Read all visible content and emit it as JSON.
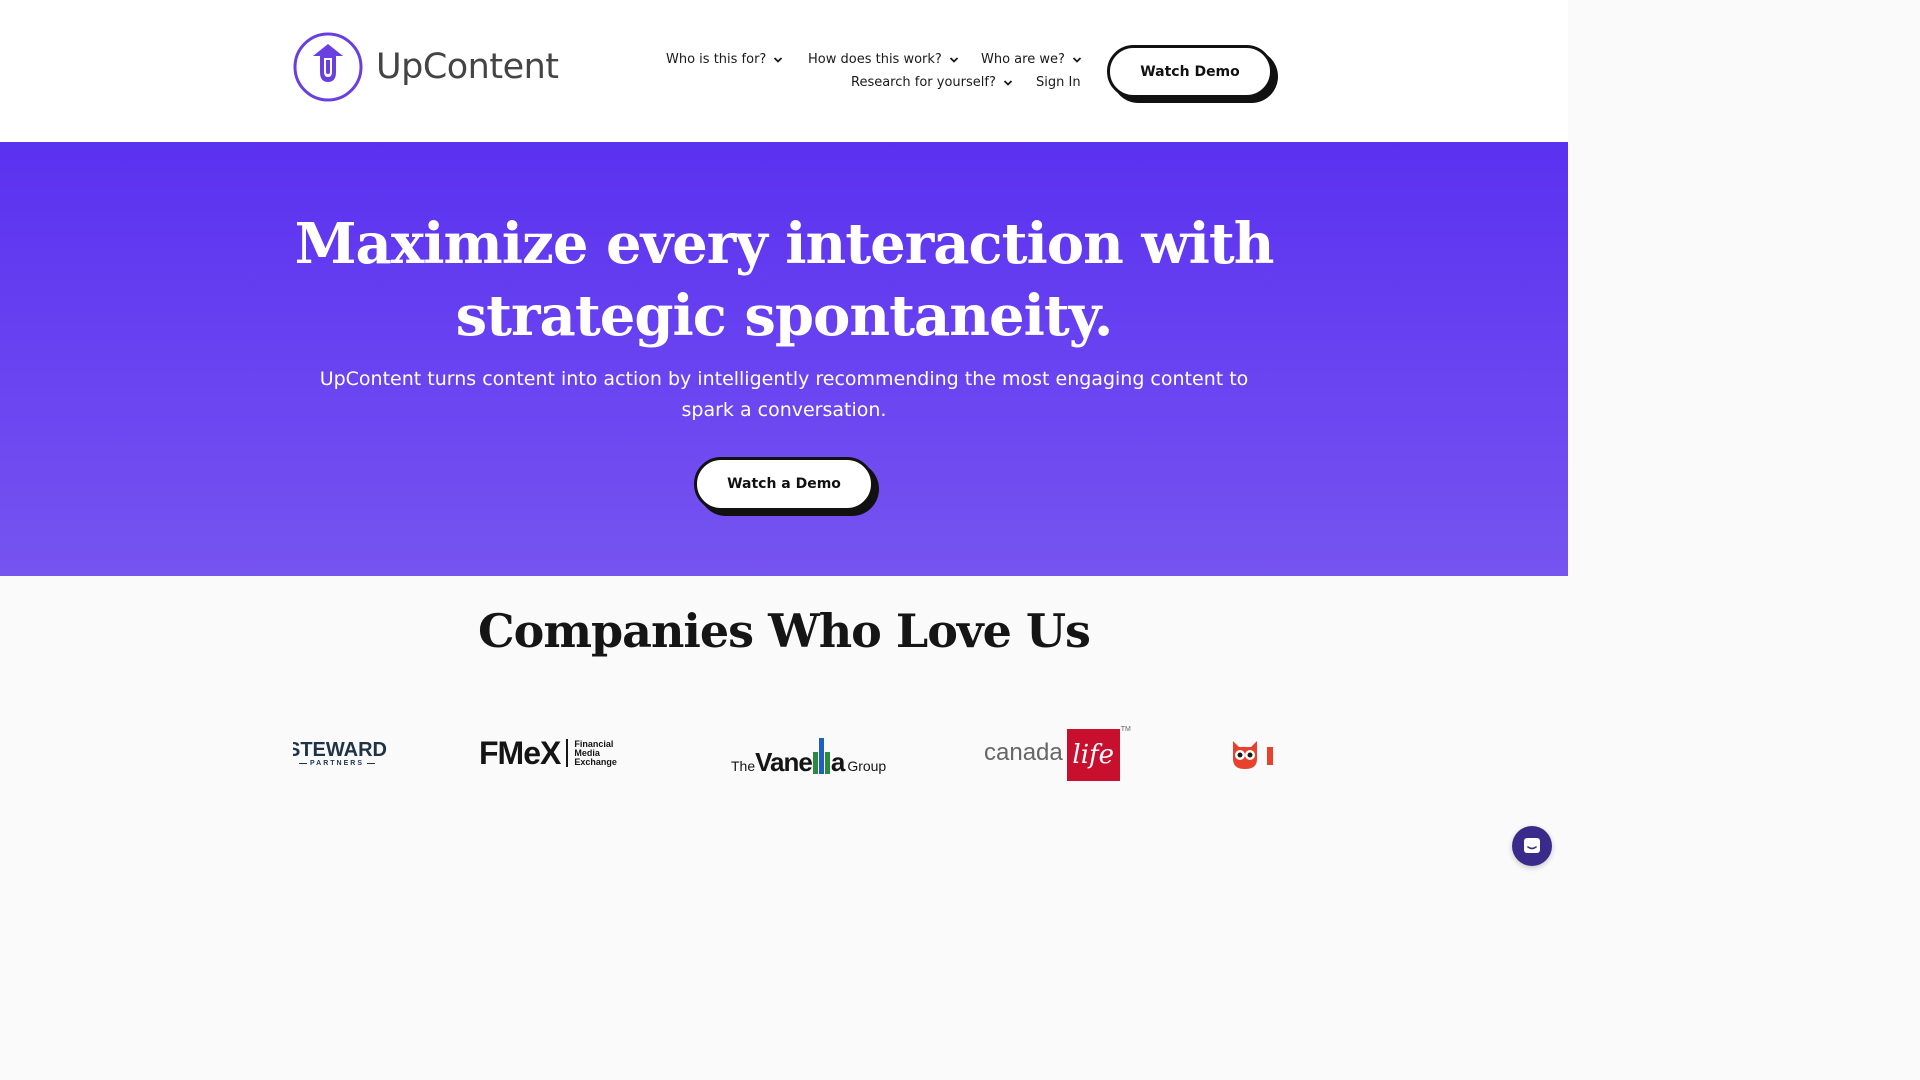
{
  "header": {
    "brand_name": "UpContent",
    "nav": {
      "who_for": "Who is this for?",
      "how_works": "How does this work?",
      "who_we_are": "Who are we?",
      "research": "Research for yourself?",
      "sign_in": "Sign In"
    },
    "cta_label": "Watch Demo"
  },
  "hero": {
    "title_line1": "Maximize every interaction with",
    "title_line2": "strategic spontaneity.",
    "subtitle_line1": "UpContent turns content into action by intelligently recommending the most engaging content to",
    "subtitle_line2": "spark a conversation.",
    "cta_label": "Watch a Demo"
  },
  "companies": {
    "title": "Companies Who Love Us",
    "logos": {
      "steward": "STEWARD",
      "steward_sub": "PARTNERS",
      "fmex": "FMeX",
      "fmex_sub1": "Financial",
      "fmex_sub2": "Media",
      "fmex_sub3": "Exchange",
      "vanella_the": "The",
      "vanella_name": "Vane",
      "vanella_a": "a",
      "vanella_group": "Group",
      "canada": "canada",
      "life": "life",
      "tm": "TM"
    }
  },
  "colors": {
    "brand_purple": "#5b31f0",
    "logo_purple": "#6a3fe0",
    "canada_life_red": "#c8102e",
    "chat_button": "#3a2a8c"
  },
  "icons": [
    "upcontent-logo-icon",
    "chevron-down-icon",
    "chat-icon"
  ]
}
